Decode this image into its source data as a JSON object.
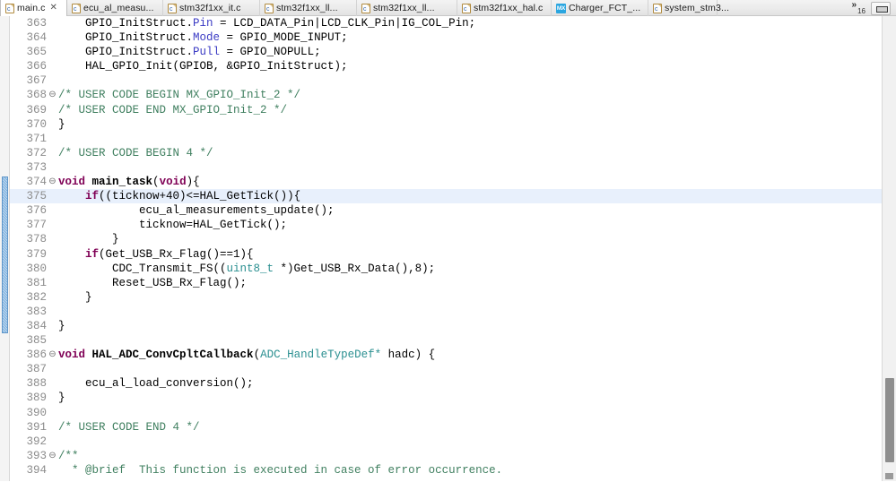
{
  "window": {
    "minimize_button_label": "",
    "minimize_icon": "restore-icon"
  },
  "tab_bar": {
    "tabs": [
      {
        "label": "main.c",
        "icon": "c-file-icon",
        "active": true,
        "closable": true
      },
      {
        "label": "ecu_al_measu...",
        "icon": "c-file-icon",
        "active": false,
        "closable": false
      },
      {
        "label": "stm32f1xx_it.c",
        "icon": "c-file-icon",
        "active": false,
        "closable": false
      },
      {
        "label": "stm32f1xx_ll...",
        "icon": "c-file-icon",
        "active": false,
        "closable": false
      },
      {
        "label": "stm32f1xx_ll...",
        "icon": "c-file-icon",
        "active": false,
        "closable": false
      },
      {
        "label": "stm32f1xx_hal.c",
        "icon": "c-file-icon",
        "active": false,
        "closable": false
      },
      {
        "label": "Charger_FCT_...",
        "icon": "cubemx-icon",
        "active": false,
        "closable": false
      },
      {
        "label": "system_stm3...",
        "icon": "c-file-icon",
        "active": false,
        "closable": false
      }
    ],
    "close_glyph": "✕",
    "overflow": {
      "chevron": "»",
      "count": "16"
    }
  },
  "editor": {
    "current_line": 375,
    "change_marker": {
      "from_line": 374,
      "to_line": 384
    },
    "fold_glyph": "⊖",
    "colors": {
      "keyword": "#7f0055",
      "comment": "#3f7f5f",
      "field": "#3b3bc4",
      "type": "#2a8f90",
      "line_number": "#8c8c8c",
      "current_line_bg": "#e8f0fc",
      "change_bar": "#79aedd",
      "mx_icon": "#2ba6e0"
    },
    "lines": [
      {
        "n": "363",
        "fold": false,
        "hl": false,
        "tokens": [
          {
            "t": "plain",
            "s": "    GPIO_InitStruct."
          },
          {
            "t": "fld",
            "s": "Pin"
          },
          {
            "t": "plain",
            "s": " = LCD_DATA_Pin|LCD_CLK_Pin|IG_COL_Pin;"
          }
        ]
      },
      {
        "n": "364",
        "fold": false,
        "hl": false,
        "tokens": [
          {
            "t": "plain",
            "s": "    GPIO_InitStruct."
          },
          {
            "t": "fld",
            "s": "Mode"
          },
          {
            "t": "plain",
            "s": " = GPIO_MODE_INPUT;"
          }
        ]
      },
      {
        "n": "365",
        "fold": false,
        "hl": false,
        "tokens": [
          {
            "t": "plain",
            "s": "    GPIO_InitStruct."
          },
          {
            "t": "fld",
            "s": "Pull"
          },
          {
            "t": "plain",
            "s": " = GPIO_NOPULL;"
          }
        ]
      },
      {
        "n": "366",
        "fold": false,
        "hl": false,
        "tokens": [
          {
            "t": "plain",
            "s": "    HAL_GPIO_Init(GPIOB, &GPIO_InitStruct);"
          }
        ]
      },
      {
        "n": "367",
        "fold": false,
        "hl": false,
        "tokens": []
      },
      {
        "n": "368",
        "fold": true,
        "hl": false,
        "tokens": [
          {
            "t": "cmt",
            "s": "/* USER CODE BEGIN MX_GPIO_Init_2 */"
          }
        ]
      },
      {
        "n": "369",
        "fold": false,
        "hl": false,
        "tokens": [
          {
            "t": "cmt",
            "s": "/* USER CODE END MX_GPIO_Init_2 */"
          }
        ]
      },
      {
        "n": "370",
        "fold": false,
        "hl": false,
        "tokens": [
          {
            "t": "plain",
            "s": "}"
          }
        ]
      },
      {
        "n": "371",
        "fold": false,
        "hl": false,
        "tokens": []
      },
      {
        "n": "372",
        "fold": false,
        "hl": false,
        "tokens": [
          {
            "t": "cmt",
            "s": "/* USER CODE BEGIN 4 */"
          }
        ]
      },
      {
        "n": "373",
        "fold": false,
        "hl": false,
        "tokens": []
      },
      {
        "n": "374",
        "fold": true,
        "hl": false,
        "tokens": [
          {
            "t": "kw",
            "s": "void"
          },
          {
            "t": "plain",
            "s": " "
          },
          {
            "t": "fn",
            "s": "main_task"
          },
          {
            "t": "plain",
            "s": "("
          },
          {
            "t": "kw",
            "s": "void"
          },
          {
            "t": "plain",
            "s": "){"
          }
        ]
      },
      {
        "n": "375",
        "fold": false,
        "hl": true,
        "tokens": [
          {
            "t": "plain",
            "s": "    "
          },
          {
            "t": "kw",
            "s": "if"
          },
          {
            "t": "plain",
            "s": "((ticknow+40)<=HAL_GetTick()){"
          }
        ]
      },
      {
        "n": "376",
        "fold": false,
        "hl": false,
        "tokens": [
          {
            "t": "plain",
            "s": "            ecu_al_measurements_update();"
          }
        ]
      },
      {
        "n": "377",
        "fold": false,
        "hl": false,
        "tokens": [
          {
            "t": "plain",
            "s": "            ticknow=HAL_GetTick();"
          }
        ]
      },
      {
        "n": "378",
        "fold": false,
        "hl": false,
        "tokens": [
          {
            "t": "plain",
            "s": "        }"
          }
        ]
      },
      {
        "n": "379",
        "fold": false,
        "hl": false,
        "tokens": [
          {
            "t": "plain",
            "s": "    "
          },
          {
            "t": "kw",
            "s": "if"
          },
          {
            "t": "plain",
            "s": "(Get_USB_Rx_Flag()==1){"
          }
        ]
      },
      {
        "n": "380",
        "fold": false,
        "hl": false,
        "tokens": [
          {
            "t": "plain",
            "s": "        CDC_Transmit_FS(("
          },
          {
            "t": "typ",
            "s": "uint8_t"
          },
          {
            "t": "plain",
            "s": " *)Get_USB_Rx_Data(),8);"
          }
        ]
      },
      {
        "n": "381",
        "fold": false,
        "hl": false,
        "tokens": [
          {
            "t": "plain",
            "s": "        Reset_USB_Rx_Flag();"
          }
        ]
      },
      {
        "n": "382",
        "fold": false,
        "hl": false,
        "tokens": [
          {
            "t": "plain",
            "s": "    }"
          }
        ]
      },
      {
        "n": "383",
        "fold": false,
        "hl": false,
        "tokens": []
      },
      {
        "n": "384",
        "fold": false,
        "hl": false,
        "tokens": [
          {
            "t": "plain",
            "s": "}"
          }
        ]
      },
      {
        "n": "385",
        "fold": false,
        "hl": false,
        "tokens": []
      },
      {
        "n": "386",
        "fold": true,
        "hl": false,
        "tokens": [
          {
            "t": "kw",
            "s": "void"
          },
          {
            "t": "plain",
            "s": " "
          },
          {
            "t": "fn",
            "s": "HAL_ADC_ConvCpltCallback"
          },
          {
            "t": "plain",
            "s": "("
          },
          {
            "t": "typ",
            "s": "ADC_HandleTypeDef*"
          },
          {
            "t": "plain",
            "s": " hadc) {"
          }
        ]
      },
      {
        "n": "387",
        "fold": false,
        "hl": false,
        "tokens": []
      },
      {
        "n": "388",
        "fold": false,
        "hl": false,
        "tokens": [
          {
            "t": "plain",
            "s": "    ecu_al_load_conversion();"
          }
        ]
      },
      {
        "n": "389",
        "fold": false,
        "hl": false,
        "tokens": [
          {
            "t": "plain",
            "s": "}"
          }
        ]
      },
      {
        "n": "390",
        "fold": false,
        "hl": false,
        "tokens": []
      },
      {
        "n": "391",
        "fold": false,
        "hl": false,
        "tokens": [
          {
            "t": "cmt",
            "s": "/* USER CODE END 4 */"
          }
        ]
      },
      {
        "n": "392",
        "fold": false,
        "hl": false,
        "tokens": []
      },
      {
        "n": "393",
        "fold": true,
        "hl": false,
        "tokens": [
          {
            "t": "cmt",
            "s": "/**"
          }
        ]
      },
      {
        "n": "394",
        "fold": false,
        "hl": false,
        "tokens": [
          {
            "t": "cmt",
            "s": "  * @brief  This function is executed in case of error occurrence."
          }
        ]
      }
    ]
  }
}
